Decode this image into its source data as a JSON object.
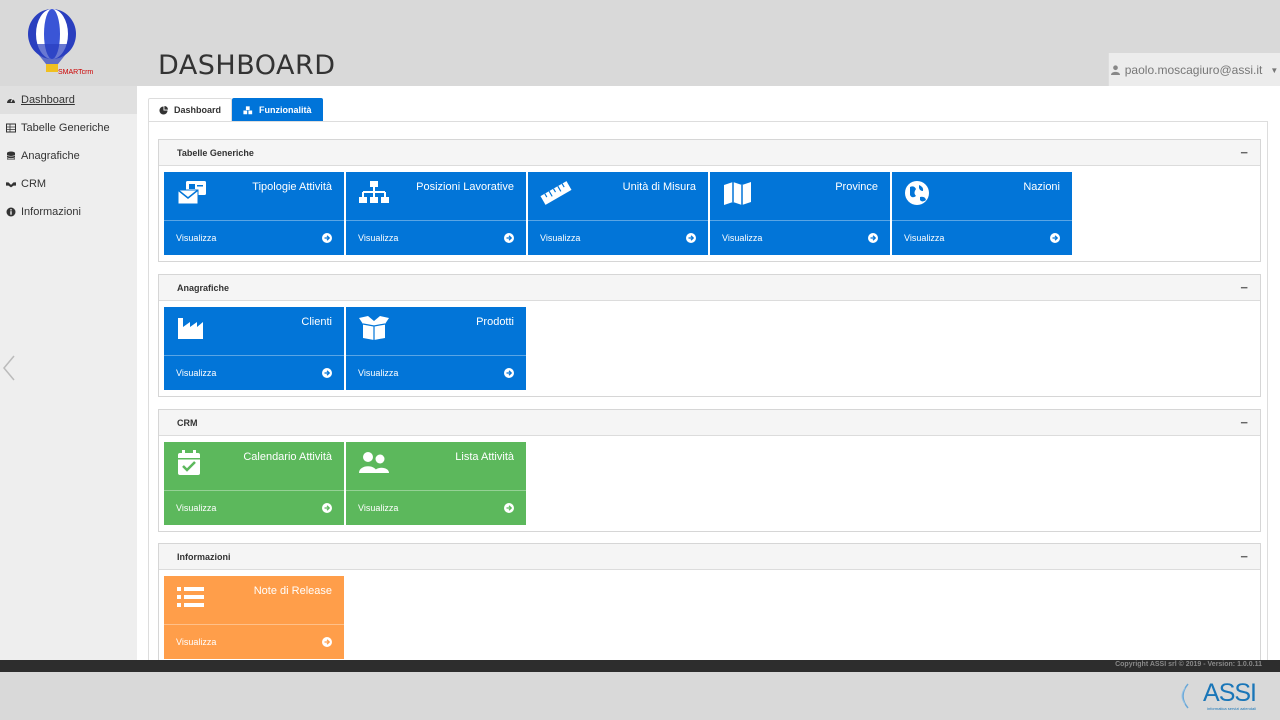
{
  "logo": {
    "text": "SMARTcrm"
  },
  "header": {
    "title": "DASHBOARD",
    "user": "paolo.moscagiuro@assi.it"
  },
  "sidebar": {
    "items": [
      {
        "label": "Dashboard",
        "icon": "dashboard-icon"
      },
      {
        "label": "Tabelle Generiche",
        "icon": "table-icon"
      },
      {
        "label": "Anagrafiche",
        "icon": "database-icon"
      },
      {
        "label": "CRM",
        "icon": "handshake-icon"
      },
      {
        "label": "Informazioni",
        "icon": "info-icon"
      }
    ]
  },
  "tabs": [
    {
      "label": "Dashboard",
      "icon": "pie-chart-icon"
    },
    {
      "label": "Funzionalità",
      "icon": "cubes-icon"
    }
  ],
  "colors": {
    "blue": "#0275d8",
    "green": "#5cb85c",
    "orange": "#ff9e4a",
    "tab_active": "#0074d9"
  },
  "panels": [
    {
      "title": "Tabelle Generiche",
      "collapse": "−",
      "cards": [
        {
          "title": "Tipologie Attività",
          "action": "Visualizza",
          "icon": "envelope-card-icon"
        },
        {
          "title": "Posizioni Lavorative",
          "action": "Visualizza",
          "icon": "sitemap-icon"
        },
        {
          "title": "Unità di Misura",
          "action": "Visualizza",
          "icon": "ruler-icon"
        },
        {
          "title": "Province",
          "action": "Visualizza",
          "icon": "map-icon"
        },
        {
          "title": "Nazioni",
          "action": "Visualizza",
          "icon": "globe-icon"
        }
      ]
    },
    {
      "title": "Anagrafiche",
      "collapse": "−",
      "cards": [
        {
          "title": "Clienti",
          "action": "Visualizza",
          "icon": "industry-icon"
        },
        {
          "title": "Prodotti",
          "action": "Visualizza",
          "icon": "box-open-icon"
        }
      ]
    },
    {
      "title": "CRM",
      "collapse": "−",
      "cards": [
        {
          "title": "Calendario Attività",
          "action": "Visualizza",
          "icon": "calendar-check-icon"
        },
        {
          "title": "Lista Attività",
          "action": "Visualizza",
          "icon": "users-icon"
        }
      ]
    },
    {
      "title": "Informazioni",
      "collapse": "−",
      "cards": [
        {
          "title": "Note di Release",
          "action": "Visualizza",
          "icon": "list-icon"
        }
      ]
    }
  ],
  "footer": {
    "copyright": "Copyright ASSI srl © 2019 - Version: 1.0.0.11",
    "brand": "ASSI",
    "brand_sub": "informatica servizi aziendali"
  }
}
